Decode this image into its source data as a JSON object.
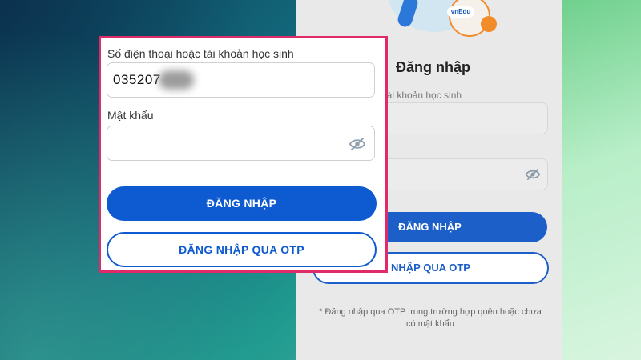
{
  "login": {
    "title": "Đăng nhập",
    "account_label": "Số điện thoại hoặc tài khoản học sinh",
    "account_label_partial": "c tài khoản học sinh",
    "account_value": "035207",
    "password_label": "Mật khẩu",
    "login_button": "ĐĂNG NHẬP",
    "otp_button": "ĐĂNG NHẬP QUA OTP",
    "otp_button_partial": "NHẬP QUA OTP",
    "otp_note": "* Đăng nhập qua OTP trong trường hợp quên hoặc chưa có mật khẩu",
    "logo_text": "vnEdu"
  },
  "colors": {
    "primary": "#0e5ad0",
    "highlight_border": "#e02a6a"
  },
  "icons": {
    "password_visibility": "eye-slash-icon"
  }
}
